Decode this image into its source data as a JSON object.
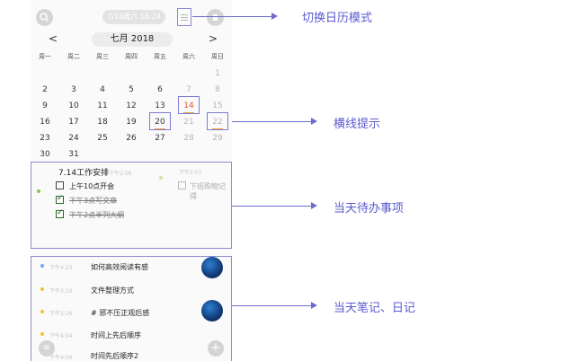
{
  "topbar": {
    "search_icon": "search-icon",
    "date_time": "7/14周六 16:24",
    "mode_icon": "list-icon",
    "trash_icon": "trash-icon"
  },
  "calendar": {
    "prev": "<",
    "next": ">",
    "month_label": "七月 2018",
    "weekdays": [
      "周一",
      "周二",
      "周三",
      "周四",
      "周五",
      "周六",
      "周日"
    ],
    "rows": [
      [
        "",
        "",
        "",
        "",
        "",
        "",
        "1"
      ],
      [
        "2",
        "3",
        "4",
        "5",
        "6",
        "7",
        "8"
      ],
      [
        "9",
        "10",
        "11",
        "12",
        "13",
        "14",
        "15"
      ],
      [
        "16",
        "17",
        "18",
        "19",
        "20",
        "21",
        "22"
      ],
      [
        "23",
        "24",
        "25",
        "26",
        "27",
        "28",
        "29"
      ],
      [
        "30",
        "31",
        "",
        "",
        "",
        "",
        ""
      ]
    ]
  },
  "tasks": {
    "title": "7.14工作安排",
    "title_time": "下午2:06",
    "side_time": "下午2:07",
    "items": [
      {
        "text": "上午10点开会",
        "done": false
      },
      {
        "text": "下午3点写文章",
        "done": true
      },
      {
        "text": "下午2点半列大纲",
        "done": true
      }
    ],
    "side_item": "下班购物记得"
  },
  "notes": {
    "items": [
      {
        "time": "下午4:23",
        "title": "如何高效阅读有感"
      },
      {
        "time": "下午3:10",
        "title": "文件整理方式"
      },
      {
        "time": "下午2:26",
        "title": "# 邪不压正观后感"
      },
      {
        "time": "下午4:04",
        "title": "时间上先后顺序"
      },
      {
        "time": "下午4:04",
        "title": "时间先后顺序2"
      }
    ],
    "menu_icon": "menu-icon",
    "add_icon": "plus-icon"
  },
  "annotations": {
    "switch_mode": "切换日历模式",
    "line_hint": "横线提示",
    "todo": "当天待办事项",
    "notes_diary": "当天笔记、日记"
  },
  "colors": {
    "annotation": "#5a5ad0",
    "highlight_box": "#7c7cd2",
    "today": "#e4553a",
    "dot_blue": "#6fa8e8",
    "dot_yellow": "#f5c12b",
    "dot_green": "#8bc34a"
  }
}
